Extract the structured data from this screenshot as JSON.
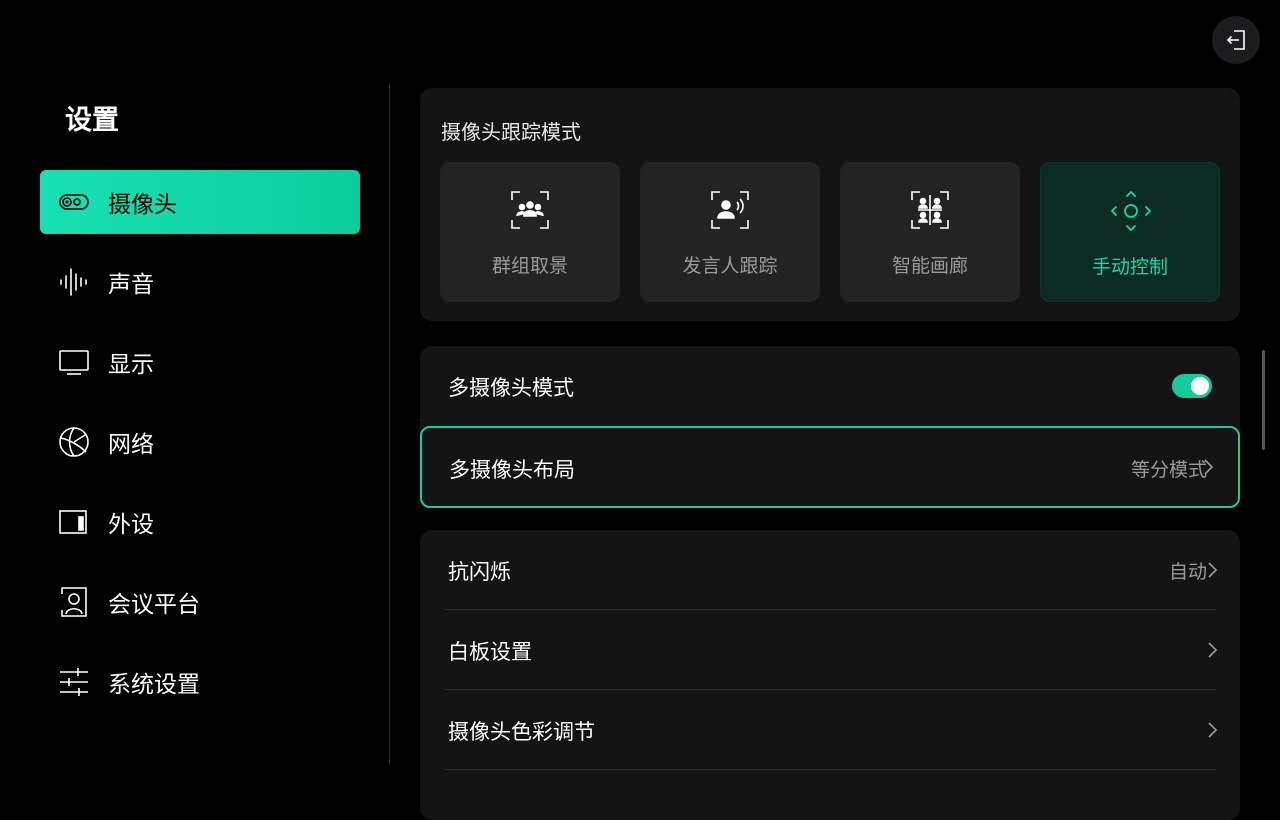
{
  "header": {
    "exit_icon": "exit-icon"
  },
  "sidebar": {
    "title": "设置",
    "items": [
      {
        "label": "摄像头",
        "icon": "camera-icon",
        "active": true
      },
      {
        "label": "声音",
        "icon": "sound-wave-icon",
        "active": false
      },
      {
        "label": "显示",
        "icon": "monitor-icon",
        "active": false
      },
      {
        "label": "网络",
        "icon": "globe-icon",
        "active": false
      },
      {
        "label": "外设",
        "icon": "peripheral-icon",
        "active": false
      },
      {
        "label": "会议平台",
        "icon": "meeting-platform-icon",
        "active": false
      },
      {
        "label": "系统设置",
        "icon": "sliders-icon",
        "active": false
      }
    ]
  },
  "tracking": {
    "title": "摄像头跟踪模式",
    "modes": [
      {
        "label": "群组取景",
        "icon": "group-framing-icon",
        "selected": false
      },
      {
        "label": "发言人跟踪",
        "icon": "speaker-tracking-icon",
        "selected": false
      },
      {
        "label": "智能画廊",
        "icon": "smart-gallery-icon",
        "selected": false
      },
      {
        "label": "手动控制",
        "icon": "manual-control-icon",
        "selected": true
      }
    ]
  },
  "multi_camera": {
    "mode_label": "多摄像头模式",
    "mode_enabled": true,
    "layout_label": "多摄像头布局",
    "layout_value": "等分模式"
  },
  "options": {
    "rows": [
      {
        "label": "抗闪烁",
        "value": "自动"
      },
      {
        "label": "白板设置",
        "value": ""
      },
      {
        "label": "摄像头色彩调节",
        "value": ""
      }
    ]
  },
  "colors": {
    "accent": "#18d7a8",
    "accent_gradient_start": "#19e0b4",
    "accent_gradient_end": "#0ccd9c",
    "background": "#000000",
    "panel": "#141414",
    "card": "#232323"
  }
}
